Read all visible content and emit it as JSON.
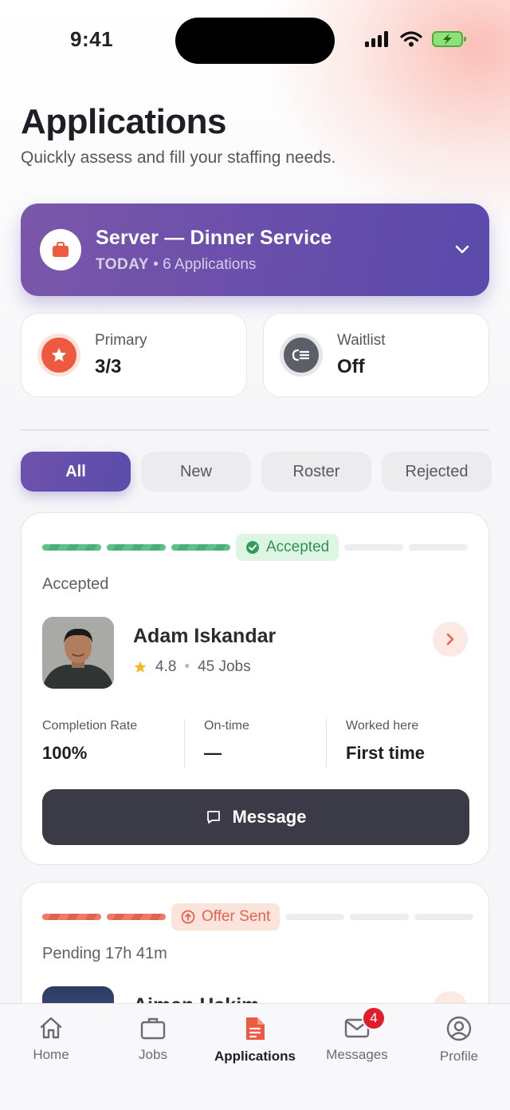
{
  "status_bar": {
    "time": "9:41"
  },
  "header": {
    "title": "Applications",
    "subtitle": "Quickly assess and fill your staffing needs."
  },
  "shift": {
    "title": "Server — Dinner Service",
    "day": "TODAY",
    "applications": "• 6 Applications"
  },
  "stats": {
    "primary": {
      "label": "Primary",
      "value": "3/3"
    },
    "waitlist": {
      "label": "Waitlist",
      "value": "Off"
    }
  },
  "filters": [
    {
      "label": "All",
      "active": true
    },
    {
      "label": "New",
      "active": false
    },
    {
      "label": "Roster",
      "active": false
    },
    {
      "label": "Rejected",
      "active": false
    }
  ],
  "applicants": [
    {
      "stage_pill": "Accepted",
      "status_text": "Accepted",
      "name": "Adam Iskandar",
      "rating": "4.8",
      "jobs": "45 Jobs",
      "metrics": [
        {
          "label": "Completion Rate",
          "value": "100%"
        },
        {
          "label": "On-time",
          "value": "—"
        },
        {
          "label": "Worked here",
          "value": "First time"
        }
      ],
      "action_label": "Message"
    },
    {
      "stage_pill": "Offer Sent",
      "status_text": "Pending 17h 41m",
      "name": "Aiman Hakim"
    }
  ],
  "tabbar": {
    "items": [
      {
        "label": "Home",
        "icon": "home-icon"
      },
      {
        "label": "Jobs",
        "icon": "briefcase-icon"
      },
      {
        "label": "Applications",
        "icon": "document-icon",
        "active": true
      },
      {
        "label": "Messages",
        "icon": "envelope-icon",
        "badge": "4"
      },
      {
        "label": "Profile",
        "icon": "user-circle-icon"
      }
    ]
  },
  "colors": {
    "accent_purple": "#6a4fab",
    "accent_orange": "#ee5a3f",
    "accepted_green": "#2f9153",
    "dark_button": "#3a3b47",
    "badge_red": "#e11d2a"
  }
}
